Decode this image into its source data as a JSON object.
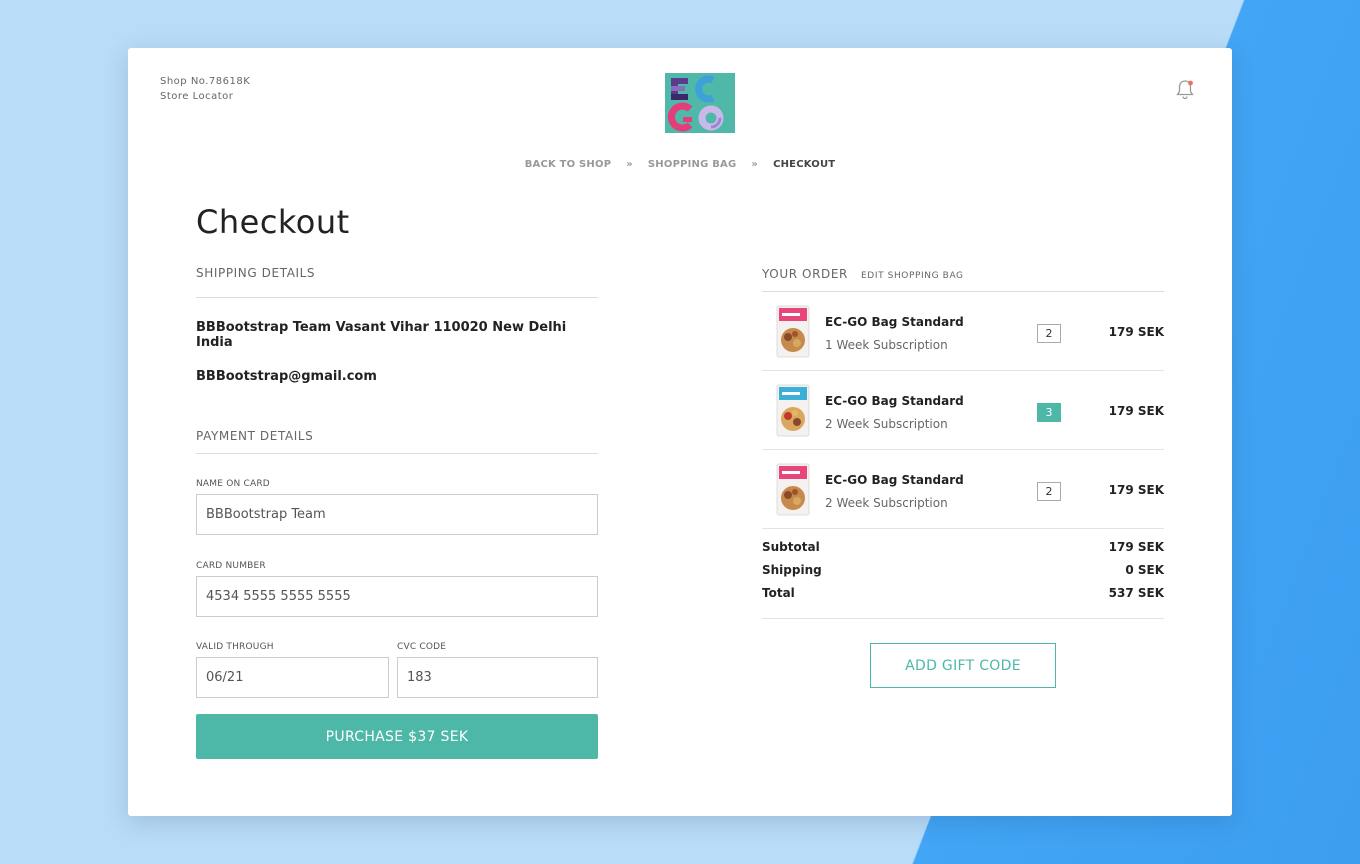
{
  "header": {
    "shop_no": "Shop No.78618K",
    "store_locator": "Store Locator",
    "logo_text": "EC GO"
  },
  "breadcrumb": {
    "back_to_shop": "BACK TO SHOP",
    "shopping_bag": "SHOPPING BAG",
    "checkout": "CHECKOUT",
    "separator": "»"
  },
  "page_title": "Checkout",
  "shipping": {
    "heading": "SHIPPING DETAILS",
    "address": "BBBootstrap Team Vasant Vihar 110020 New Delhi India",
    "email": "BBBootstrap@gmail.com"
  },
  "payment": {
    "heading": "PAYMENT DETAILS",
    "name_label": "NAME ON CARD",
    "name_value": "BBBootstrap Team",
    "card_label": "CARD NUMBER",
    "card_value": "4534 5555 5555 5555",
    "valid_label": "VALID THROUGH",
    "valid_value": "06/21",
    "cvc_label": "CVC CODE",
    "cvc_value": "183",
    "purchase_label": "PURCHASE $37 SEK"
  },
  "order": {
    "heading": "YOUR ORDER",
    "edit_label": "EDIT SHOPPING BAG",
    "items": [
      {
        "name": "EC-GO Bag Standard",
        "subscription": "1 Week Subscription",
        "qty": "2",
        "price": "179 SEK",
        "qty_active": false,
        "thumb_color": "#e8457a"
      },
      {
        "name": "EC-GO Bag Standard",
        "subscription": "2 Week Subscription",
        "qty": "3",
        "price": "179 SEK",
        "qty_active": true,
        "thumb_color": "#3ab0d8"
      },
      {
        "name": "EC-GO Bag Standard",
        "subscription": "2 Week Subscription",
        "qty": "2",
        "price": "179 SEK",
        "qty_active": false,
        "thumb_color": "#e8457a"
      }
    ],
    "subtotal_label": "Subtotal",
    "subtotal_value": "179 SEK",
    "shipping_label": "Shipping",
    "shipping_value": "0 SEK",
    "total_label": "Total",
    "total_value": "537 SEK",
    "gift_label": "ADD GIFT CODE"
  },
  "colors": {
    "accent": "#4db8a8",
    "background_light": "#b9dcf8",
    "background_dark": "#42a5f5"
  }
}
